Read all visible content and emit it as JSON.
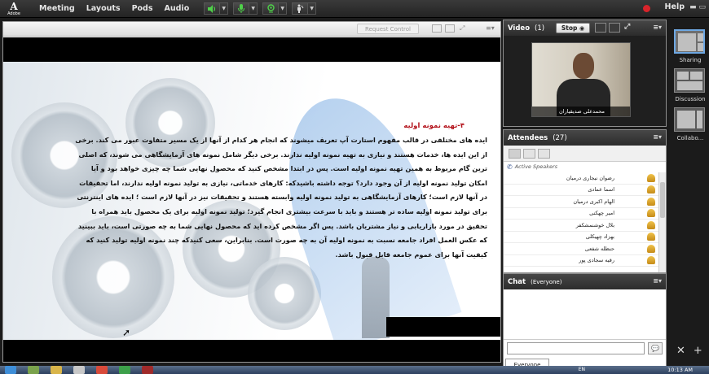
{
  "menubar": {
    "logo_text": "Adobe",
    "items": [
      "Meeting",
      "Layouts",
      "Pods",
      "Audio"
    ],
    "help": "Help"
  },
  "share_pod": {
    "request_control": "Request Control"
  },
  "slide": {
    "heading": "۴-تهیه نمونه اولیه",
    "lines": [
      "ایده های مختلفی در قالب مفهوم استارت آپ تعریف میشوند که انجام هر کدام از آنها از یک مسیر متفاوت عبور می کند. برخی",
      "از این ایده ها، خدمات هستند و نیازی به تهیه نمونه اولیه ندارند. برخی دیگر شامل نمونه های آزمایشگاهی می شوند، که اصلی",
      "ترین گام مربوط به همین تهیه نمونه اولیه است. پس در ابتدا مشخص کنید که محصول نهایی شما چه چیزی خواهد بود و آیا",
      "امکان تولید نمونه اولیه از آن وجود دارد؟ توجه داشته باشیدکه: کارهای خدماتی، نیازی به تولید نمونه اولیه ندارند، اما تحقیقات",
      "در آنها لازم است؛ کارهای آزمایشگاهی به تولید نمونه اولیه وابسته هستند و تحقیقات نیز در آنها لازم است ؛ ایده های اینترنتی",
      "برای تولید نمونه اولیه ساده تر هستند و باید با سرعت بیشتری انجام گیرد؛ تولید نمونه اولیه برای یک محصول باید همراه با",
      "تحقیق در مورد بازاریابی و نیاز مشتریان باشد. پس اگر مشخص کرده اید که محصول نهایی شما به چه صورتی است، باید ببینید",
      "که عکس العمل افراد جامعه نسبت به نمونه اولیه آن به چه صورت است. بنابراین، سعی کنیدکه چند نمونه اولیه تولید کنید که",
      "کیفیت آنها برای عموم جامعه قابل قبول باشد."
    ]
  },
  "video_pod": {
    "title": "Video",
    "count": "(1)",
    "stop_label": "Stop",
    "participant_name": "محمدعلی صدیقیاران"
  },
  "attendees_pod": {
    "title": "Attendees",
    "count": "(27)",
    "active_speakers": "Active Speakers",
    "attendees": [
      "رضوان نیجاری درمیان",
      "اسما عمادی",
      "الهام اکبری درمیان",
      "امیر چهکنی",
      "بلال خوشنمشکفر",
      "بهزاد چهیکلی",
      "حنظله شفعی",
      "رقیه سجادی پور"
    ]
  },
  "chat_pod": {
    "title": "Chat",
    "scope": "(Everyone)",
    "tab": "Everyone"
  },
  "layouts": {
    "items": [
      "Sharing",
      "Discussion",
      "Collabo..."
    ]
  },
  "taskbar": {
    "lang": "EN",
    "clock": "10:13 AM"
  },
  "colors": {
    "menubar_bg": "#2c2c2c",
    "heading_red": "#b3121b",
    "pod_title_bg": "#3a3a3a",
    "active_layout_border": "#6ea8e3",
    "record_red": "#d9242b"
  }
}
